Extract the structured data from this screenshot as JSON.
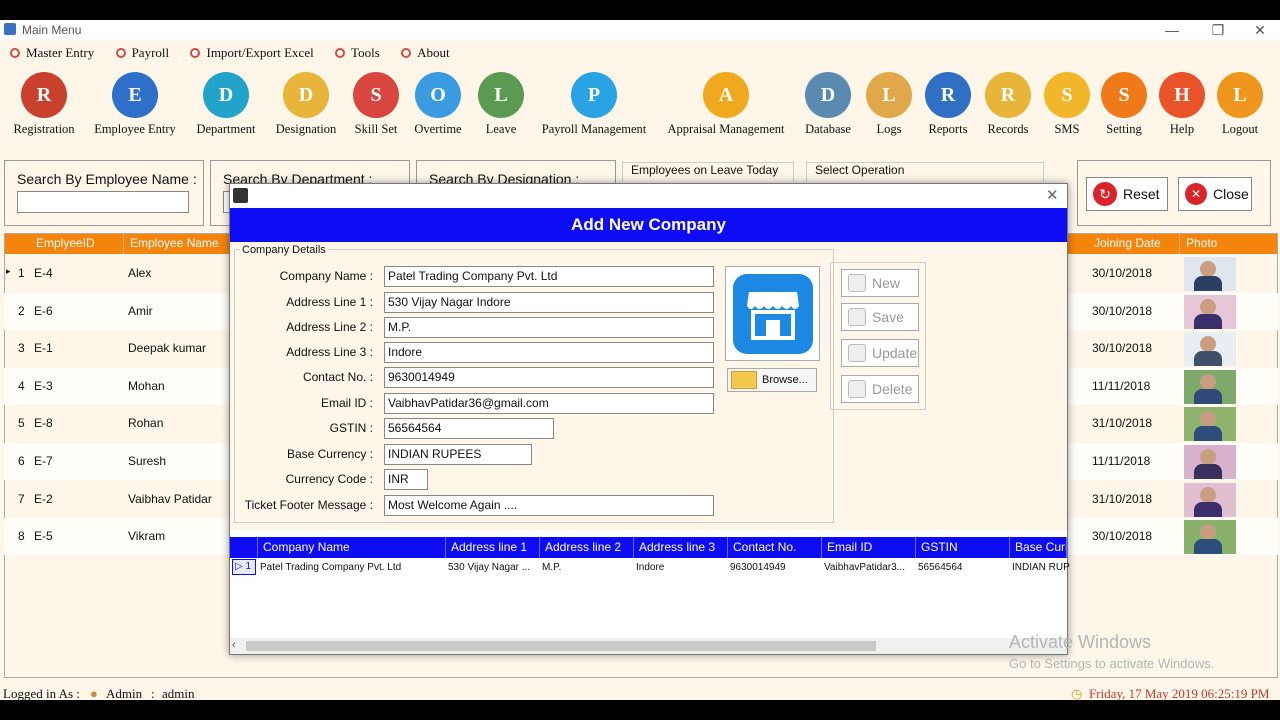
{
  "window": {
    "title": "Main Menu"
  },
  "menu": [
    "Master Entry",
    "Payroll",
    "Import/Export Excel",
    "Tools",
    "About"
  ],
  "toolbar": [
    {
      "label": "Registration",
      "icon": "registration-icon",
      "color": "#c9412d"
    },
    {
      "label": "Employee Entry",
      "icon": "employee-entry-icon",
      "color": "#2d6fc9"
    },
    {
      "label": "Department",
      "icon": "department-icon",
      "color": "#22a3c9"
    },
    {
      "label": "Designation",
      "icon": "designation-icon",
      "color": "#e8b43a"
    },
    {
      "label": "Skill Set",
      "icon": "skill-set-icon",
      "color": "#d9463f"
    },
    {
      "label": "Overtime",
      "icon": "overtime-icon",
      "color": "#3b9be0"
    },
    {
      "label": "Leave",
      "icon": "leave-icon",
      "color": "#5a9a52"
    },
    {
      "label": "Payroll Management",
      "icon": "payroll-management-icon",
      "color": "#29a3e3"
    },
    {
      "label": "Appraisal Management",
      "icon": "appraisal-management-icon",
      "color": "#f0a81c"
    },
    {
      "label": "Database",
      "icon": "database-icon",
      "color": "#5a8ab0"
    },
    {
      "label": "Logs",
      "icon": "logs-icon",
      "color": "#e0a84a"
    },
    {
      "label": "Reports",
      "icon": "reports-icon",
      "color": "#2f6fc4"
    },
    {
      "label": "Records",
      "icon": "records-icon",
      "color": "#e8b43a"
    },
    {
      "label": "SMS",
      "icon": "sms-icon",
      "color": "#f2b62a"
    },
    {
      "label": "Setting",
      "icon": "setting-icon",
      "color": "#f07a1a"
    },
    {
      "label": "Help",
      "icon": "help-icon",
      "color": "#e8532a"
    },
    {
      "label": "Logout",
      "icon": "logout-icon",
      "color": "#f0961c"
    }
  ],
  "search": {
    "by_name": "Search By Employee Name :",
    "by_department": "Search By Department :",
    "by_designation": "Search By Designation :",
    "on_leave": "Employees on Leave Today",
    "select_operation": "Select Operation",
    "reset": "Reset",
    "close": "Close"
  },
  "grid": {
    "columns": [
      "EmplyeeID",
      "Employee Name",
      "Joining Date",
      "Photo"
    ],
    "rows": [
      {
        "n": "1",
        "id": "E-4",
        "name": "Alex",
        "date": "30/10/2018"
      },
      {
        "n": "2",
        "id": "E-6",
        "name": "Amir",
        "date": "30/10/2018"
      },
      {
        "n": "3",
        "id": "E-1",
        "name": "Deepak kumar",
        "date": "30/10/2018"
      },
      {
        "n": "4",
        "id": "E-3",
        "name": "Mohan",
        "date": "11/11/2018"
      },
      {
        "n": "5",
        "id": "E-8",
        "name": "Rohan",
        "date": "31/10/2018"
      },
      {
        "n": "6",
        "id": "E-7",
        "name": "Suresh",
        "date": "11/11/2018"
      },
      {
        "n": "7",
        "id": "E-2",
        "name": "Vaibhav Patidar",
        "date": "31/10/2018"
      },
      {
        "n": "8",
        "id": "E-5",
        "name": "Vikram",
        "date": "30/10/2018"
      }
    ]
  },
  "status": {
    "logged_in": "Logged in As :",
    "user": "Admin",
    "sep": ":",
    "role": "admin",
    "datetime": "Friday, 17 May 2019 06:25:19 PM"
  },
  "dialog": {
    "header": "Add New Company",
    "group": "Company Details",
    "fields": [
      {
        "label": "Company Name :",
        "value": "Patel Trading Company Pvt. Ltd"
      },
      {
        "label": "Address Line 1 :",
        "value": "530 Vijay Nagar Indore"
      },
      {
        "label": "Address Line 2 :",
        "value": "M.P."
      },
      {
        "label": "Address Line 3 :",
        "value": "Indore"
      },
      {
        "label": "Contact No. :",
        "value": "9630014949"
      },
      {
        "label": "Email ID :",
        "value": "VaibhavPatidar36@gmail.com"
      },
      {
        "label": "GSTIN :",
        "value": "56564564"
      },
      {
        "label": "Base Currency :",
        "value": "INDIAN RUPEES"
      },
      {
        "label": "Currency Code :",
        "value": "INR"
      },
      {
        "label": "Ticket Footer Message :",
        "value": "Most Welcome Again ...."
      }
    ],
    "browse": "Browse...",
    "buttons": [
      "New",
      "Save",
      "Update",
      "Delete"
    ],
    "grid_columns": [
      "Company Name",
      "Address line 1",
      "Address line 2",
      "Address line 3",
      "Contact No.",
      "Email ID",
      "GSTIN",
      "Base Curr"
    ],
    "grid_row": {
      "n": "1",
      "cells": [
        "Patel Trading Company Pvt. Ltd",
        "530 Vijay Nagar ...",
        "M.P.",
        "Indore",
        "9630014949",
        "VaibhavPatidar3...",
        "56564564",
        "INDIAN RUP"
      ]
    }
  },
  "watermark": {
    "line1": "Activate Windows",
    "line2": "Go to Settings to activate Windows."
  }
}
